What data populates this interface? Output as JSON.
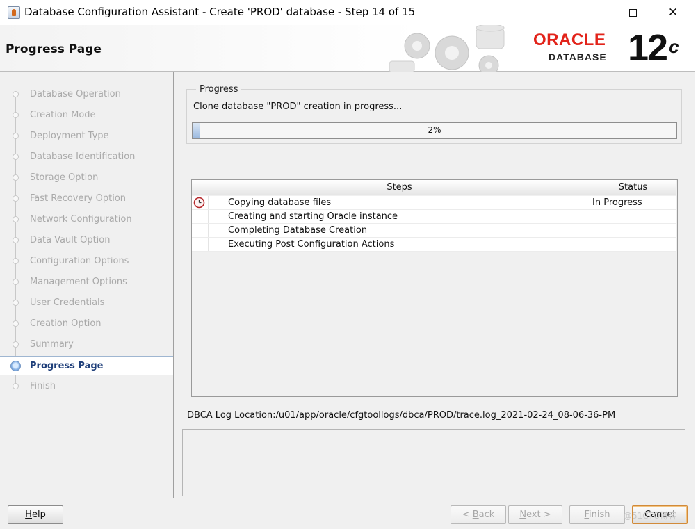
{
  "window": {
    "title": "Database Configuration Assistant - Create 'PROD' database - Step 14 of 15",
    "controls": {
      "minimize_icon": "minimize-icon",
      "maximize_icon": "maximize-icon",
      "close_symbol": "✕"
    }
  },
  "header": {
    "page_title": "Progress Page",
    "logo": {
      "brand": "ORACLE",
      "product": "DATABASE",
      "version": "12",
      "version_suffix": "c"
    }
  },
  "sidebar": {
    "items": [
      {
        "label": "Database Operation",
        "state": "done"
      },
      {
        "label": "Creation Mode",
        "state": "done"
      },
      {
        "label": "Deployment Type",
        "state": "done"
      },
      {
        "label": "Database Identification",
        "state": "done"
      },
      {
        "label": "Storage Option",
        "state": "done"
      },
      {
        "label": "Fast Recovery Option",
        "state": "done"
      },
      {
        "label": "Network Configuration",
        "state": "done"
      },
      {
        "label": "Data Vault Option",
        "state": "done"
      },
      {
        "label": "Configuration Options",
        "state": "done"
      },
      {
        "label": "Management Options",
        "state": "done"
      },
      {
        "label": "User Credentials",
        "state": "done"
      },
      {
        "label": "Creation Option",
        "state": "done"
      },
      {
        "label": "Summary",
        "state": "done"
      },
      {
        "label": "Progress Page",
        "state": "active"
      },
      {
        "label": "Finish",
        "state": "pending"
      }
    ]
  },
  "progress": {
    "group_title": "Progress",
    "message": "Clone database \"PROD\" creation in progress...",
    "percent_text": "2%",
    "percent_value": 2
  },
  "steps_table": {
    "columns": {
      "steps": "Steps",
      "status": "Status"
    },
    "rows": [
      {
        "step": "Copying database files",
        "status": "In Progress",
        "icon": "clock-icon"
      },
      {
        "step": "Creating and starting Oracle instance",
        "status": "",
        "icon": ""
      },
      {
        "step": "Completing Database Creation",
        "status": "",
        "icon": ""
      },
      {
        "step": "Executing Post Configuration Actions",
        "status": "",
        "icon": ""
      }
    ]
  },
  "log": {
    "label": "DBCA Log Location:/u01/app/oracle/cfgtoollogs/dbca/PROD/trace.log_2021-02-24_08-06-36-PM"
  },
  "buttons": {
    "help": {
      "mnemonic": "H",
      "rest": "elp"
    },
    "back": {
      "prefix": "< ",
      "mnemonic": "B",
      "rest": "ack"
    },
    "next": {
      "mnemonic": "N",
      "rest": "ext >"
    },
    "finish": {
      "mnemonic": "F",
      "rest": "inish"
    },
    "cancel": {
      "label": "Cancel"
    }
  },
  "watermark": "@51CTO博客",
  "colors": {
    "oracle_red": "#e2231a",
    "active_step_text": "#1f3f7a",
    "progress_fill": "#9ab8de",
    "cancel_focus": "#d18a3a"
  }
}
